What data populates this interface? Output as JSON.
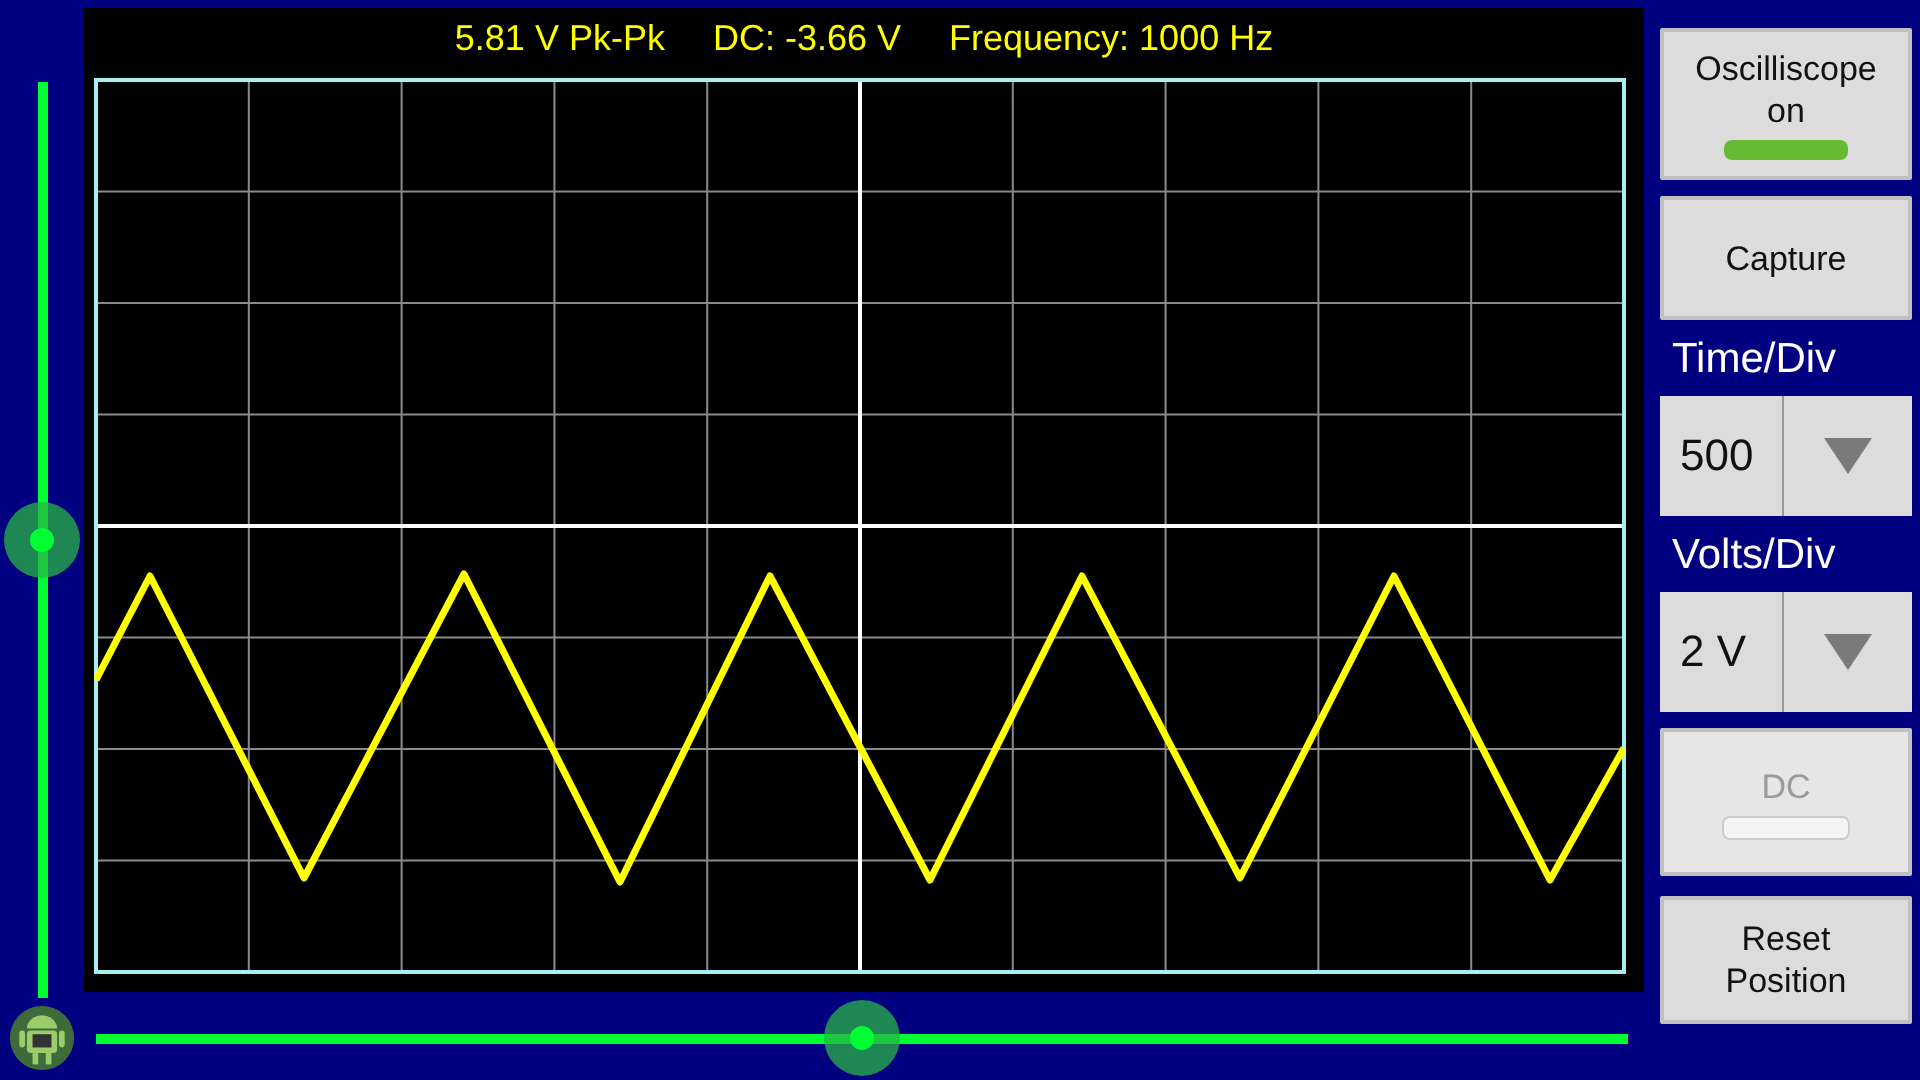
{
  "readouts": [
    {
      "text": "5.81 V Pk-Pk"
    },
    {
      "text": "DC: -3.66 V"
    },
    {
      "text": "Frequency: 1000 Hz"
    }
  ],
  "vertical_slider": {
    "level": 0.5
  },
  "horizontal_slider": {
    "level": 0.5
  },
  "power_toggle": {
    "label": "Oscilliscope on",
    "on": true,
    "disabled": false
  },
  "capture_button": {
    "label": "Capture"
  },
  "time_div": {
    "label": "Time/Div",
    "value": "500"
  },
  "volts_div": {
    "label": "Volts/Div",
    "value": "2 V"
  },
  "coupling_toggle": {
    "label": "DC",
    "on": false,
    "disabled": true
  },
  "reset_button": {
    "label": "Reset Position"
  }
}
